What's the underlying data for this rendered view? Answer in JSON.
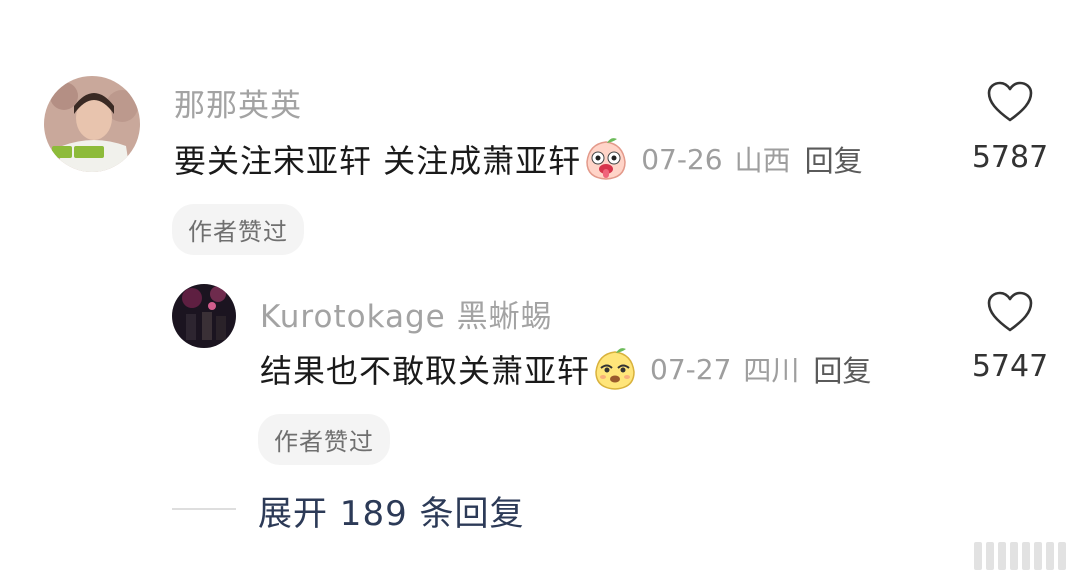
{
  "comment": {
    "username": "那那英英",
    "text": "要关注宋亚轩 关注成萧亚轩",
    "date": "07-26",
    "location": "山西",
    "reply_label": "回复",
    "like_count": "5787",
    "badge": "作者赞过",
    "emoji": "drooling-peach-emoji"
  },
  "reply": {
    "username": "Kurotokage 黑蜥蜴",
    "text": "结果也不敢取关萧亚轩",
    "date": "07-27",
    "location": "四川",
    "reply_label": "回复",
    "like_count": "5747",
    "badge": "作者赞过",
    "emoji": "smirking-pear-emoji"
  },
  "expand": {
    "label": "展开 189 条回复"
  },
  "colors": {
    "username": "#a3a3a3",
    "text": "#1a1a1a",
    "expand": "#2c3a57",
    "badge_bg": "#f4f4f4"
  }
}
